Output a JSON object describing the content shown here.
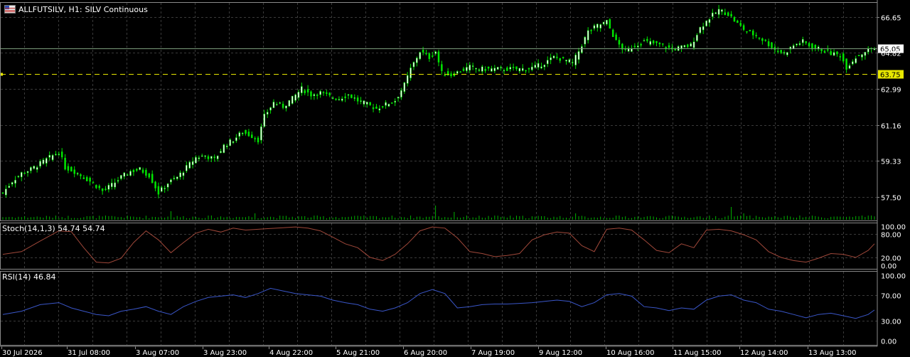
{
  "header": {
    "symbol": "ALLFUTSILV, H1:",
    "description": "SILV Continuous"
  },
  "colors": {
    "background": "#000000",
    "grid": "#3a3a3a",
    "candle_bull": "#ffffff",
    "candle_bear": "#00e600",
    "current_price_line": "#7a9a7a",
    "alert_line": "#e6e600",
    "stoch_main": "#a0483a",
    "rsi_line": "#3a56c8",
    "volume": "#00b400"
  },
  "chart_data": [
    {
      "type": "candlestick",
      "title": "ALLFUTSILV, H1: SILV Continuous",
      "y_ticks": [
        "66.65",
        "64.82",
        "62.99",
        "61.16",
        "59.33",
        "57.50"
      ],
      "ylim": [
        56.3,
        67.4
      ],
      "current_price": "65.05",
      "alert_price": "63.75",
      "x_ticks": [
        "30 Jul 2026",
        "31 Jul 08:00",
        "3 Aug 07:00",
        "3 Aug 23:00",
        "4 Aug 22:00",
        "5 Aug 21:00",
        "6 Aug 20:00",
        "7 Aug 19:00",
        "9 Aug 12:00",
        "10 Aug 16:00",
        "11 Aug 15:00",
        "12 Aug 14:00",
        "13 Aug 13:00"
      ],
      "close_path": [
        [
          0,
          57.7
        ],
        [
          3,
          58.3
        ],
        [
          6,
          58.7
        ],
        [
          9,
          58.9
        ],
        [
          12,
          59.2
        ],
        [
          15,
          59.5
        ],
        [
          18,
          59.8
        ],
        [
          20,
          59.0
        ],
        [
          23,
          58.8
        ],
        [
          26,
          58.5
        ],
        [
          29,
          58.2
        ],
        [
          32,
          57.8
        ],
        [
          35,
          58.1
        ],
        [
          38,
          58.5
        ],
        [
          41,
          58.8
        ],
        [
          44,
          58.9
        ],
        [
          47,
          58.6
        ],
        [
          50,
          57.7
        ],
        [
          53,
          58.2
        ],
        [
          56,
          58.5
        ],
        [
          59,
          59.0
        ],
        [
          62,
          59.5
        ],
        [
          65,
          59.6
        ],
        [
          68,
          59.4
        ],
        [
          71,
          60.1
        ],
        [
          74,
          60.4
        ],
        [
          77,
          60.8
        ],
        [
          80,
          60.6
        ],
        [
          82,
          60.4
        ],
        [
          84,
          61.6
        ],
        [
          87,
          62.3
        ],
        [
          90,
          62.1
        ],
        [
          93,
          62.5
        ],
        [
          96,
          63.0
        ],
        [
          99,
          62.7
        ],
        [
          102,
          62.8
        ],
        [
          105,
          62.6
        ],
        [
          108,
          62.5
        ],
        [
          111,
          62.7
        ],
        [
          114,
          62.4
        ],
        [
          117,
          62.2
        ],
        [
          120,
          62.0
        ],
        [
          123,
          62.2
        ],
        [
          126,
          62.4
        ],
        [
          129,
          63.2
        ],
        [
          131,
          64.0
        ],
        [
          134,
          64.9
        ],
        [
          137,
          64.6
        ],
        [
          139,
          64.9
        ],
        [
          141,
          63.8
        ],
        [
          144,
          63.7
        ],
        [
          147,
          63.9
        ],
        [
          150,
          64.1
        ],
        [
          153,
          64.0
        ],
        [
          156,
          64.0
        ],
        [
          159,
          64.0
        ],
        [
          162,
          64.0
        ],
        [
          165,
          64.0
        ],
        [
          168,
          64.0
        ],
        [
          171,
          64.1
        ],
        [
          174,
          64.3
        ],
        [
          177,
          64.6
        ],
        [
          180,
          64.5
        ],
        [
          183,
          64.3
        ],
        [
          185,
          64.9
        ],
        [
          188,
          65.9
        ],
        [
          191,
          66.2
        ],
        [
          194,
          66.4
        ],
        [
          197,
          65.4
        ],
        [
          200,
          64.9
        ],
        [
          203,
          65.2
        ],
        [
          206,
          65.4
        ],
        [
          209,
          65.3
        ],
        [
          212,
          65.2
        ],
        [
          215,
          65.0
        ],
        [
          218,
          65.1
        ],
        [
          221,
          65.2
        ],
        [
          224,
          66.1
        ],
        [
          227,
          66.6
        ],
        [
          230,
          67.0
        ],
        [
          233,
          66.8
        ],
        [
          236,
          66.3
        ],
        [
          239,
          65.9
        ],
        [
          242,
          65.7
        ],
        [
          245,
          65.4
        ],
        [
          248,
          65.0
        ],
        [
          251,
          64.8
        ],
        [
          254,
          65.2
        ],
        [
          257,
          65.4
        ],
        [
          260,
          65.1
        ],
        [
          263,
          65.0
        ],
        [
          266,
          64.8
        ],
        [
          269,
          64.7
        ],
        [
          271,
          64.1
        ],
        [
          274,
          64.6
        ],
        [
          277,
          64.9
        ],
        [
          279,
          65.05
        ]
      ],
      "volume_spikes": [
        [
          54,
          0.6
        ],
        [
          81,
          0.45
        ],
        [
          139,
          1.0
        ],
        [
          145,
          0.55
        ],
        [
          184,
          0.45
        ],
        [
          234,
          0.9
        ],
        [
          238,
          0.45
        ]
      ]
    },
    {
      "type": "line",
      "title": "Stoch(14,1,3) 54.74 54.74",
      "y_ticks": [
        "100.00",
        "80.00",
        "20.00",
        "0.00"
      ],
      "ylim": [
        0,
        100
      ],
      "levels": [
        80,
        20
      ],
      "points": [
        [
          0,
          28
        ],
        [
          6,
          35
        ],
        [
          12,
          62
        ],
        [
          18,
          88
        ],
        [
          22,
          86
        ],
        [
          26,
          45
        ],
        [
          30,
          8
        ],
        [
          34,
          6
        ],
        [
          38,
          18
        ],
        [
          42,
          58
        ],
        [
          46,
          88
        ],
        [
          50,
          65
        ],
        [
          54,
          32
        ],
        [
          58,
          58
        ],
        [
          62,
          82
        ],
        [
          66,
          92
        ],
        [
          70,
          85
        ],
        [
          74,
          95
        ],
        [
          78,
          90
        ],
        [
          82,
          92
        ],
        [
          86,
          94
        ],
        [
          90,
          96
        ],
        [
          94,
          98
        ],
        [
          98,
          95
        ],
        [
          102,
          88
        ],
        [
          106,
          72
        ],
        [
          110,
          55
        ],
        [
          114,
          45
        ],
        [
          118,
          20
        ],
        [
          122,
          12
        ],
        [
          126,
          28
        ],
        [
          130,
          55
        ],
        [
          134,
          88
        ],
        [
          138,
          98
        ],
        [
          142,
          95
        ],
        [
          146,
          70
        ],
        [
          150,
          35
        ],
        [
          154,
          30
        ],
        [
          158,
          22
        ],
        [
          162,
          25
        ],
        [
          166,
          30
        ],
        [
          170,
          65
        ],
        [
          174,
          78
        ],
        [
          178,
          85
        ],
        [
          182,
          82
        ],
        [
          186,
          50
        ],
        [
          190,
          35
        ],
        [
          194,
          92
        ],
        [
          198,
          95
        ],
        [
          202,
          90
        ],
        [
          206,
          65
        ],
        [
          210,
          38
        ],
        [
          214,
          32
        ],
        [
          218,
          55
        ],
        [
          222,
          45
        ],
        [
          226,
          90
        ],
        [
          230,
          92
        ],
        [
          234,
          88
        ],
        [
          238,
          78
        ],
        [
          242,
          65
        ],
        [
          246,
          35
        ],
        [
          250,
          20
        ],
        [
          254,
          12
        ],
        [
          258,
          8
        ],
        [
          262,
          18
        ],
        [
          266,
          30
        ],
        [
          270,
          28
        ],
        [
          274,
          20
        ],
        [
          278,
          38
        ],
        [
          280,
          55
        ]
      ]
    },
    {
      "type": "line",
      "title": "RSI(14) 46.84",
      "y_ticks": [
        "100.00",
        "70.00",
        "30.00",
        "0.00"
      ],
      "ylim": [
        0,
        100
      ],
      "levels": [
        70,
        30
      ],
      "points": [
        [
          0,
          40
        ],
        [
          6,
          45
        ],
        [
          12,
          55
        ],
        [
          18,
          58
        ],
        [
          22,
          50
        ],
        [
          26,
          45
        ],
        [
          30,
          40
        ],
        [
          34,
          38
        ],
        [
          38,
          45
        ],
        [
          42,
          48
        ],
        [
          46,
          52
        ],
        [
          50,
          45
        ],
        [
          54,
          40
        ],
        [
          58,
          52
        ],
        [
          62,
          60
        ],
        [
          66,
          66
        ],
        [
          70,
          68
        ],
        [
          74,
          70
        ],
        [
          78,
          66
        ],
        [
          82,
          72
        ],
        [
          86,
          80
        ],
        [
          90,
          76
        ],
        [
          94,
          72
        ],
        [
          98,
          70
        ],
        [
          102,
          68
        ],
        [
          106,
          62
        ],
        [
          110,
          58
        ],
        [
          114,
          55
        ],
        [
          118,
          48
        ],
        [
          122,
          45
        ],
        [
          126,
          50
        ],
        [
          130,
          58
        ],
        [
          134,
          72
        ],
        [
          138,
          78
        ],
        [
          142,
          72
        ],
        [
          146,
          50
        ],
        [
          150,
          52
        ],
        [
          154,
          55
        ],
        [
          158,
          56
        ],
        [
          162,
          56
        ],
        [
          166,
          57
        ],
        [
          170,
          58
        ],
        [
          174,
          60
        ],
        [
          178,
          62
        ],
        [
          182,
          60
        ],
        [
          186,
          52
        ],
        [
          190,
          58
        ],
        [
          194,
          70
        ],
        [
          198,
          72
        ],
        [
          202,
          68
        ],
        [
          206,
          52
        ],
        [
          210,
          50
        ],
        [
          214,
          46
        ],
        [
          218,
          50
        ],
        [
          222,
          48
        ],
        [
          226,
          62
        ],
        [
          230,
          68
        ],
        [
          234,
          70
        ],
        [
          238,
          62
        ],
        [
          242,
          58
        ],
        [
          246,
          48
        ],
        [
          250,
          45
        ],
        [
          254,
          40
        ],
        [
          258,
          35
        ],
        [
          262,
          40
        ],
        [
          266,
          42
        ],
        [
          270,
          38
        ],
        [
          274,
          34
        ],
        [
          278,
          40
        ],
        [
          280,
          46.84
        ]
      ]
    }
  ]
}
